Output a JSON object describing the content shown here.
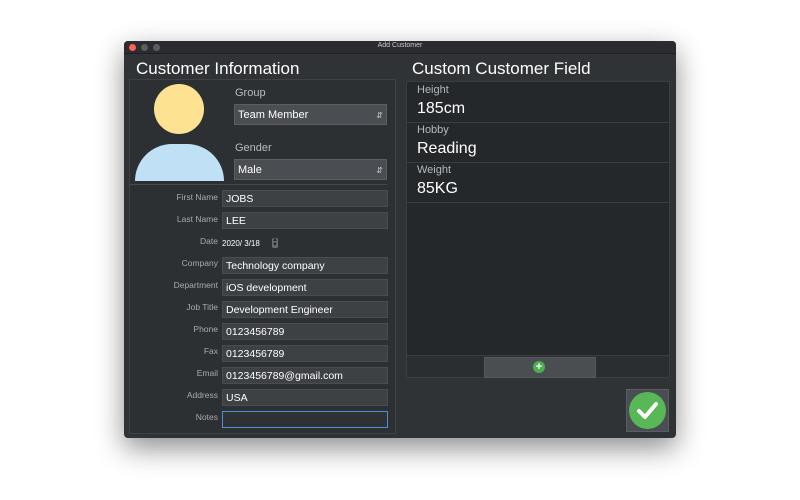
{
  "window": {
    "title": "Add Customer",
    "traffic_lights": {
      "close": "#fe5f57",
      "minimize": "#5b5d61",
      "zoom": "#5b5d61"
    }
  },
  "customer_info": {
    "heading": "Customer Information",
    "avatar_icon": "person-avatar-icon",
    "group_label": "Group",
    "group_value": "Team Member",
    "gender_label": "Gender",
    "gender_value": "Male",
    "fields": {
      "first_name": {
        "label": "First Name",
        "value": "JOBS"
      },
      "last_name": {
        "label": "Last Name",
        "value": "LEE"
      },
      "date": {
        "label": "Date",
        "value": "2020/  3/18"
      },
      "company": {
        "label": "Company",
        "value": "Technology company"
      },
      "department": {
        "label": "Department",
        "value": "iOS development"
      },
      "job_title": {
        "label": "Job Title",
        "value": "Development Engineer"
      },
      "phone": {
        "label": "Phone",
        "value": "0123456789"
      },
      "fax": {
        "label": "Fax",
        "value": "0123456789"
      },
      "email": {
        "label": "Email",
        "value": "0123456789@gmail.com"
      },
      "address": {
        "label": "Address",
        "value": "USA"
      },
      "notes": {
        "label": "Notes",
        "value": ""
      }
    }
  },
  "custom_fields": {
    "heading": "Custom Customer Field",
    "items": [
      {
        "label": "Height",
        "value": "185cm"
      },
      {
        "label": "Hobby",
        "value": "Reading"
      },
      {
        "label": "Weight",
        "value": "85KG"
      }
    ],
    "add_icon": "plus-circle-icon",
    "accent": "#4caf50"
  },
  "confirm": {
    "icon": "checkmark-icon",
    "color": "#58b858"
  }
}
